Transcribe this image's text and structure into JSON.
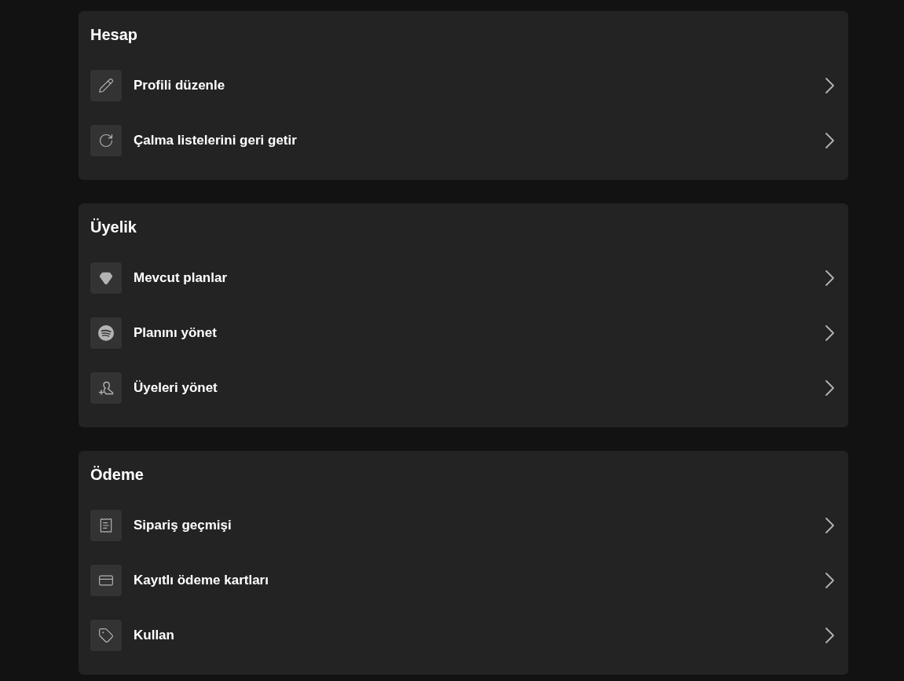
{
  "sections": [
    {
      "title": "Hesap",
      "items": [
        {
          "label": "Profili düzenle"
        },
        {
          "label": "Çalma listelerini geri getir"
        }
      ]
    },
    {
      "title": "Üyelik",
      "items": [
        {
          "label": "Mevcut planlar"
        },
        {
          "label": "Planını yönet"
        },
        {
          "label": "Üyeleri yönet"
        }
      ]
    },
    {
      "title": "Ödeme",
      "items": [
        {
          "label": "Sipariş geçmişi"
        },
        {
          "label": "Kayıtlı ödeme kartları"
        },
        {
          "label": "Kullan"
        }
      ]
    }
  ]
}
